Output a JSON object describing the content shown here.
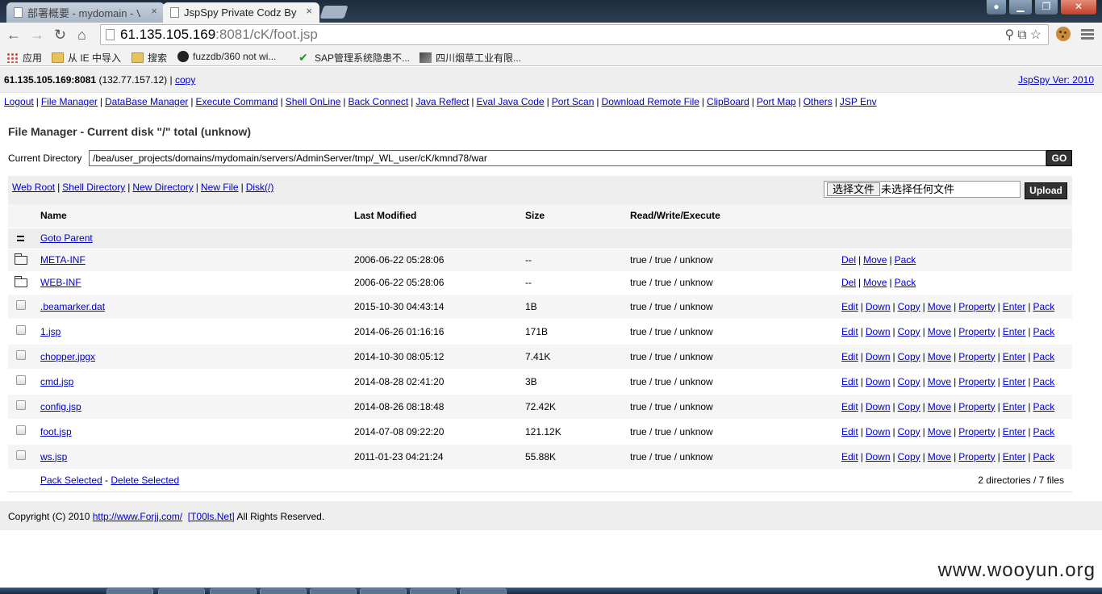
{
  "browser": {
    "tabs": [
      {
        "label": "部署概要 - mydomain - V",
        "active": false
      },
      {
        "label": "JspSpy Private Codz By",
        "active": true
      }
    ],
    "close_glyph": "×",
    "address": {
      "host": "61.135.105.169",
      "path": ":8081/cK/foot.jsp"
    },
    "bookmarks": [
      {
        "label": "应用",
        "icon": "apps-icon"
      },
      {
        "label": "从 IE 中导入",
        "icon": "folder-icon"
      },
      {
        "label": "搜索",
        "icon": "folder-icon"
      },
      {
        "label": "fuzzdb/360 not wi...",
        "icon": "github-icon"
      },
      {
        "label": "SAP管理系统隐患不...",
        "icon": "sap-icon"
      },
      {
        "label": "四川烟草工业有限...",
        "icon": "image-icon"
      }
    ]
  },
  "header": {
    "host_bold": "61.135.105.169:8081",
    "host_ip": " (132.77.157.12) | ",
    "copy_label": "copy",
    "version": "JspSpy Ver: 2010"
  },
  "menu": [
    "Logout",
    "File Manager",
    "DataBase Manager",
    "Execute Command",
    "Shell OnLine",
    "Back Connect",
    "Java Reflect",
    "Eval Java Code",
    "Port Scan",
    "Download Remote File",
    "ClipBoard",
    "Port Map",
    "Others",
    "JSP Env"
  ],
  "filemanager": {
    "title": "File Manager - Current disk \"/\" total (unknow)",
    "current_dir_label": "Current Directory",
    "current_dir": "/bea/user_projects/domains/mydomain/servers/AdminServer/tmp/_WL_user/cK/kmnd78/war",
    "go_label": "GO",
    "quick_links": [
      "Web Root",
      "Shell Directory",
      "New Directory",
      "New File",
      "Disk(/)"
    ],
    "choose_file_label": "选择文件",
    "no_file_label": "未选择任何文件",
    "upload_label": "Upload",
    "columns": {
      "name": "Name",
      "modified": "Last Modified",
      "size": "Size",
      "perm": "Read/Write/Execute"
    },
    "goto_parent": "Goto Parent",
    "dir_actions": [
      "Del",
      "Move",
      "Pack"
    ],
    "file_actions": [
      "Edit",
      "Down",
      "Copy",
      "Move",
      "Property",
      "Enter",
      "Pack"
    ],
    "directories": [
      {
        "name": "META-INF",
        "modified": "2006-06-22 05:28:06",
        "size": "--",
        "perm": "true / true / unknow"
      },
      {
        "name": "WEB-INF",
        "modified": "2006-06-22 05:28:06",
        "size": "--",
        "perm": "true / true / unknow"
      }
    ],
    "files": [
      {
        "name": ".beamarker.dat",
        "modified": "2015-10-30 04:43:14",
        "size": "1B",
        "perm": "true / true / unknow"
      },
      {
        "name": "1.jsp",
        "modified": "2014-06-26 01:16:16",
        "size": "171B",
        "perm": "true / true / unknow"
      },
      {
        "name": "chopper.jpgx",
        "modified": "2014-10-30 08:05:12",
        "size": "7.41K",
        "perm": "true / true / unknow"
      },
      {
        "name": "cmd.jsp",
        "modified": "2014-08-28 02:41:20",
        "size": "3B",
        "perm": "true / true / unknow"
      },
      {
        "name": "config.jsp",
        "modified": "2014-08-26 08:18:48",
        "size": "72.42K",
        "perm": "true / true / unknow"
      },
      {
        "name": "foot.jsp",
        "modified": "2014-07-08 09:22:20",
        "size": "121.12K",
        "perm": "true / true / unknow"
      },
      {
        "name": "ws.jsp",
        "modified": "2011-01-23 04:21:24",
        "size": "55.88K",
        "perm": "true / true / unknow"
      }
    ],
    "pack_selected": "Pack Selected",
    "delete_selected": "Delete Selected",
    "summary": "2 directories / 7 files"
  },
  "footer": {
    "copyright_prefix": "Copyright (C) 2010 ",
    "link1": "http://www.Forjj.com/",
    "link2": "[T00ls.Net]",
    "suffix": " All Rights Reserved."
  },
  "watermark": "www.wooyun.org"
}
